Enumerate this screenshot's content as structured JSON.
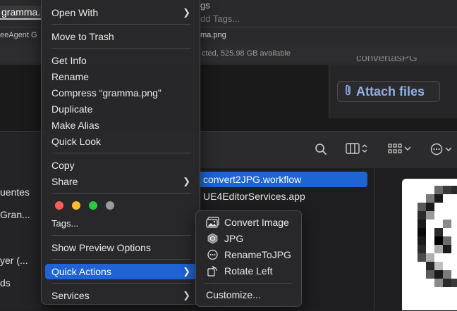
{
  "background": {
    "top_window": {
      "tab_label": "gramma.",
      "tab_fragment": "eeAgent G",
      "tags_fragment": "gs",
      "add_tags_placeholder": "dd Tags...",
      "filename_fragment": "ma.png",
      "status_text": "cted, 525.98 GB available"
    },
    "note_window": {
      "attach_label": "Attach files",
      "partial_text": "convertasPG"
    },
    "bottom_window": {
      "sidebar_items": [
        "uentes",
        "Gran...",
        "yer (...",
        "ds"
      ],
      "files": [
        {
          "name": "convert2JPG.workflow",
          "selected": true
        },
        {
          "name": "UE4EditorServices.app",
          "selected": false
        }
      ]
    }
  },
  "context_menu": {
    "items": {
      "open_with": "Open With",
      "move_to_trash": "Move to Trash",
      "get_info": "Get Info",
      "rename": "Rename",
      "compress": "Compress “gramma.png”",
      "duplicate": "Duplicate",
      "make_alias": "Make Alias",
      "quick_look": "Quick Look",
      "copy": "Copy",
      "share": "Share",
      "tags": "Tags...",
      "show_preview_options": "Show Preview Options",
      "quick_actions": "Quick Actions",
      "services": "Services"
    },
    "tag_colors": {
      "red": "#ff5f57",
      "orange": "#febc2e",
      "green": "#28c840",
      "gray": "#9a9a9e"
    },
    "highlight_color": "#1f63d6"
  },
  "submenu": {
    "items": {
      "convert_image": "Convert Image",
      "jpg": "JPG",
      "rename_to_jpg": "RenameToJPG",
      "rotate_left": "Rotate Left",
      "customize": "Customize..."
    }
  }
}
